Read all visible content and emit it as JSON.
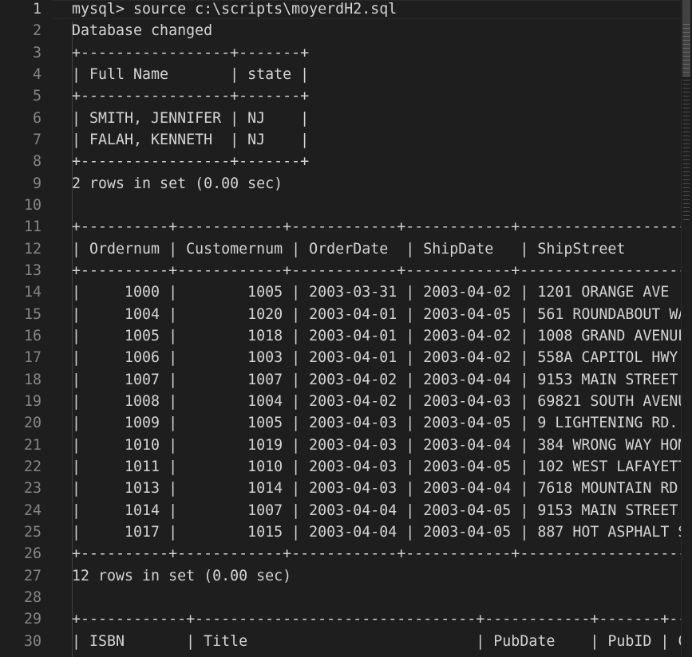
{
  "editor": {
    "lines": [
      {
        "n": "1",
        "text": "mysql> source c:\\scripts\\moyerdH2.sql"
      },
      {
        "n": "2",
        "text": "Database changed"
      },
      {
        "n": "3",
        "text": "+-----------------+-------+"
      },
      {
        "n": "4",
        "text": "| Full Name       | state |"
      },
      {
        "n": "5",
        "text": "+-----------------+-------+"
      },
      {
        "n": "6",
        "text": "| SMITH, JENNIFER | NJ    |"
      },
      {
        "n": "7",
        "text": "| FALAH, KENNETH  | NJ    |"
      },
      {
        "n": "8",
        "text": "+-----------------+-------+"
      },
      {
        "n": "9",
        "text": "2 rows in set (0.00 sec)"
      },
      {
        "n": "10",
        "text": ""
      },
      {
        "n": "11",
        "text": "+----------+------------+------------+------------+--------------------"
      },
      {
        "n": "12",
        "text": "| Ordernum | Customernum | OrderDate  | ShipDate   | ShipStreet"
      },
      {
        "n": "13",
        "text": "+----------+------------+------------+------------+--------------------"
      },
      {
        "n": "14",
        "text": "|     1000 |        1005 | 2003-03-31 | 2003-04-02 | 1201 ORANGE AVE"
      },
      {
        "n": "15",
        "text": "|     1004 |        1020 | 2003-04-01 | 2003-04-05 | 561 ROUNDABOUT WA"
      },
      {
        "n": "16",
        "text": "|     1005 |        1018 | 2003-04-01 | 2003-04-02 | 1008 GRAND AVENUE"
      },
      {
        "n": "17",
        "text": "|     1006 |        1003 | 2003-04-01 | 2003-04-02 | 558A CAPITOL HWY."
      },
      {
        "n": "18",
        "text": "|     1007 |        1007 | 2003-04-02 | 2003-04-04 | 9153 MAIN STREET"
      },
      {
        "n": "19",
        "text": "|     1008 |        1004 | 2003-04-02 | 2003-04-03 | 69821 SOUTH AVENU"
      },
      {
        "n": "20",
        "text": "|     1009 |        1005 | 2003-04-03 | 2003-04-05 | 9 LIGHTENING RD."
      },
      {
        "n": "21",
        "text": "|     1010 |        1019 | 2003-04-03 | 2003-04-04 | 384 WRONG WAY HOM"
      },
      {
        "n": "22",
        "text": "|     1011 |        1010 | 2003-04-03 | 2003-04-05 | 102 WEST LAFAYETT"
      },
      {
        "n": "23",
        "text": "|     1013 |        1014 | 2003-04-03 | 2003-04-04 | 7618 MOUNTAIN RD."
      },
      {
        "n": "24",
        "text": "|     1014 |        1007 | 2003-04-04 | 2003-04-05 | 9153 MAIN STREET"
      },
      {
        "n": "25",
        "text": "|     1017 |        1015 | 2003-04-04 | 2003-04-05 | 887 HOT ASPHALT S"
      },
      {
        "n": "26",
        "text": "+----------+------------+------------+------------+--------------------"
      },
      {
        "n": "27",
        "text": "12 rows in set (0.00 sec)"
      },
      {
        "n": "28",
        "text": ""
      },
      {
        "n": "29",
        "text": "+------------+--------------------------------+------------+-------+--"
      },
      {
        "n": "30",
        "text": "| ISBN       | Title                          | PubDate    | PubID | C"
      }
    ]
  }
}
